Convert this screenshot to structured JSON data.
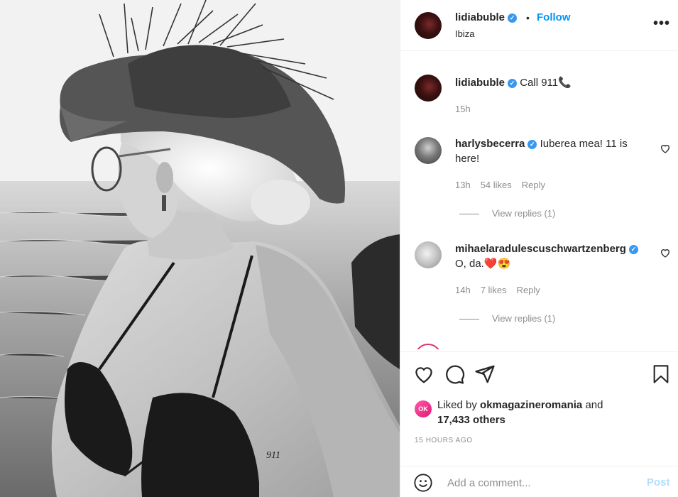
{
  "post": {
    "author": "lidiabuble",
    "follow_label": "Follow",
    "separator": "•",
    "location": "Ibiza",
    "more_label": "•••",
    "photo_tattoo": "911"
  },
  "caption": {
    "username": "lidiabuble",
    "text": "Call 911",
    "emoji": "📞",
    "time": "15h"
  },
  "comments": [
    {
      "username": "harlysbecerra",
      "text": "Iuberea mea! 11 is here!",
      "time": "13h",
      "likes": "54 likes",
      "reply_label": "Reply",
      "view_replies": "View replies (1)"
    },
    {
      "username": "mihaelaradulescuschwartzenberg",
      "text": "O, da.",
      "emojis": "❤️😍",
      "time": "14h",
      "likes": "7 likes",
      "reply_label": "Reply",
      "view_replies": "View replies (1)"
    }
  ],
  "likes": {
    "prefix": "Liked by",
    "user": "okmagazineromania",
    "and": "and",
    "count": "17,433 others"
  },
  "timestamp": "15 HOURS AGO",
  "comment_box": {
    "placeholder": "Add a comment...",
    "post_label": "Post"
  },
  "icons": {
    "like": "heart-icon",
    "comment": "comment-icon",
    "share": "paper-plane-icon",
    "save": "bookmark-icon",
    "emoji": "smiley-icon"
  },
  "colors": {
    "link": "#0095f6",
    "verified": "#3897f0",
    "muted": "#8e8e8e",
    "post_disabled": "#b2dffc"
  }
}
